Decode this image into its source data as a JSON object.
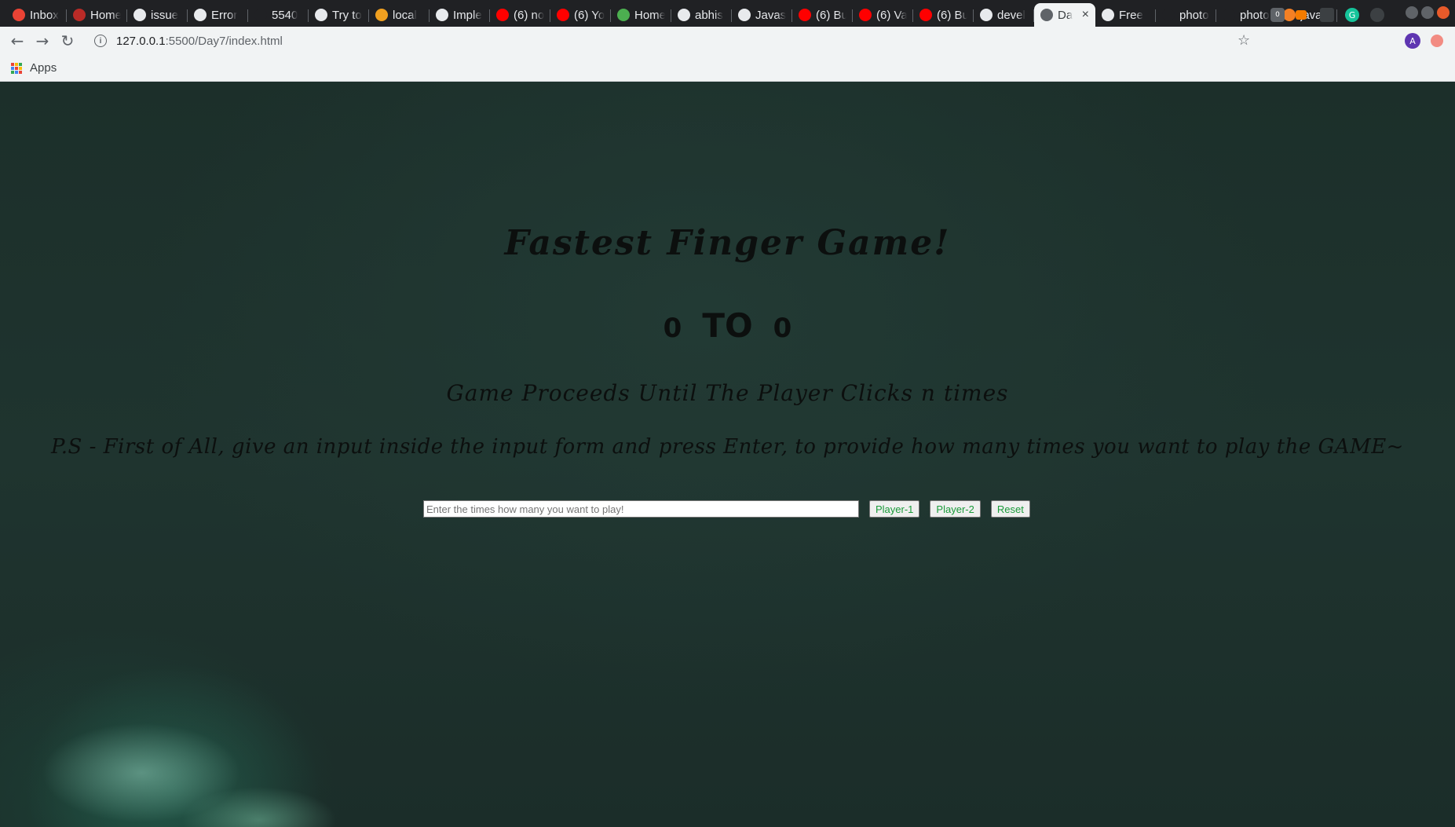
{
  "browser": {
    "tabs": [
      {
        "label": "Inbox",
        "icon": "gmail-icon",
        "color": "#ea4335"
      },
      {
        "label": "Home",
        "icon": "quora-icon",
        "color": "#b92b27"
      },
      {
        "label": "issue",
        "icon": "github-icon",
        "color": "#e8eaed"
      },
      {
        "label": "Error",
        "icon": "github-icon",
        "color": "#e8eaed"
      },
      {
        "label": "5540",
        "icon": "blank-icon",
        "color": "#202124"
      },
      {
        "label": "Try to",
        "icon": "github-icon",
        "color": "#e8eaed"
      },
      {
        "label": "local",
        "icon": "netlify-icon",
        "color": "#f0a020"
      },
      {
        "label": "Imple",
        "icon": "github-icon",
        "color": "#e8eaed"
      },
      {
        "label": "(6) no",
        "icon": "youtube-icon",
        "color": "#ff0000"
      },
      {
        "label": "(6) Yo",
        "icon": "youtube-icon",
        "color": "#ff0000"
      },
      {
        "label": "Home",
        "icon": "leaf-icon",
        "color": "#4caf50"
      },
      {
        "label": "abhis",
        "icon": "github-icon",
        "color": "#e8eaed"
      },
      {
        "label": "Javas",
        "icon": "github-icon",
        "color": "#e8eaed"
      },
      {
        "label": "(6) Bu",
        "icon": "youtube-icon",
        "color": "#ff0000"
      },
      {
        "label": "(6) Va",
        "icon": "youtube-icon",
        "color": "#ff0000"
      },
      {
        "label": "(6) Bu",
        "icon": "youtube-icon",
        "color": "#ff0000"
      },
      {
        "label": "devel",
        "icon": "github-icon",
        "color": "#e8eaed"
      },
      {
        "label": "Da",
        "icon": "globe-icon",
        "color": "#5f6368",
        "active": true
      },
      {
        "label": "Free",
        "icon": "unsplash-icon",
        "color": "#e8eaed"
      },
      {
        "label": "photo",
        "icon": "blank-icon",
        "color": "#202124"
      },
      {
        "label": "photo",
        "icon": "blank-icon",
        "color": "#202124"
      },
      {
        "label": "javas",
        "icon": "stackoverflow-icon",
        "color": "#f48024"
      }
    ],
    "url_host": "127.0.0.1",
    "url_path": ":5500/Day7/index.html",
    "bookmarks_apps_label": "Apps",
    "profile_initial": "A",
    "extension_badge": "0"
  },
  "game": {
    "title": "Fastest Finger Game!",
    "score_left": "0",
    "score_separator": "TO",
    "score_right": "0",
    "subtitle": "Game Proceeds Until The Player Clicks n times",
    "note": "P.S - First of All, give an input inside the input form and press Enter, to provide how many times you want to play the GAME~",
    "input_placeholder": "Enter the times how many you want to play!",
    "input_value": "",
    "player1_label": "Player-1",
    "player2_label": "Player-2",
    "reset_label": "Reset",
    "button_text_color": "#1a9a3a"
  }
}
